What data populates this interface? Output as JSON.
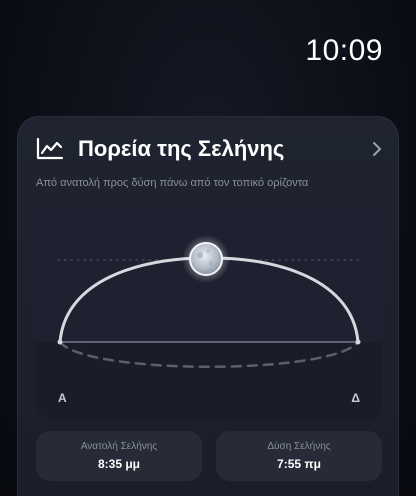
{
  "status_bar": {
    "time": "10:09"
  },
  "moon_card": {
    "icon": "line-chart-icon",
    "title": "Πορεία της Σελήνης",
    "subtitle": "Από ανατολή προς δύση πάνω από τον τοπικό ορίζοντα",
    "chevron_icon": "chevron-right-icon",
    "direction_east": "Α",
    "direction_west": "Δ",
    "moonrise": {
      "label": "Ανατολή Σελήνης",
      "value": "8:35 μμ"
    },
    "moonset": {
      "label": "Δύση Σελήνης",
      "value": "7:55 πμ"
    }
  },
  "colors": {
    "background": "#0b0e15",
    "card": "#1f2430",
    "plot": "#1e2230",
    "arc": "#d6d8de",
    "muted_text": "#8a909c"
  }
}
